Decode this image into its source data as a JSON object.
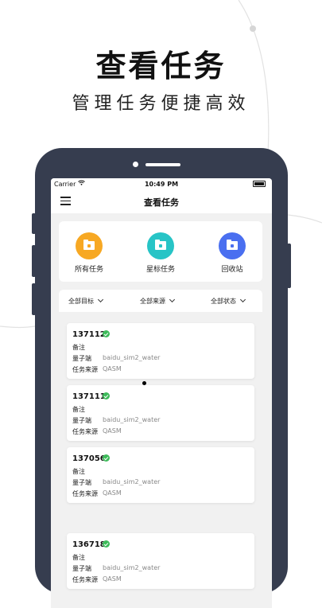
{
  "promo": {
    "title": "查看任务",
    "subtitle": "管理任务便捷高效"
  },
  "status_bar": {
    "carrier": "Carrier",
    "time": "10:49 PM"
  },
  "nav": {
    "title": "查看任务"
  },
  "categories": [
    {
      "label": "所有任务",
      "color": "#f7a823"
    },
    {
      "label": "星标任务",
      "color": "#27c4c6"
    },
    {
      "label": "回收站",
      "color": "#4a6ff0"
    }
  ],
  "filters": [
    {
      "label": "全部目标"
    },
    {
      "label": "全部来源"
    },
    {
      "label": "全部状态"
    }
  ],
  "field_labels": {
    "note": "备注",
    "quantum": "量子端",
    "source": "任务来源"
  },
  "tasks": [
    {
      "id": "137112",
      "note": "",
      "quantum": "baidu_sim2_water",
      "source": "QASM"
    },
    {
      "id": "137111",
      "note": "",
      "quantum": "baidu_sim2_water",
      "source": "QASM"
    },
    {
      "id": "137056",
      "note": "",
      "quantum": "baidu_sim2_water",
      "source": "QASM"
    },
    {
      "id": "136718",
      "note": "",
      "quantum": "baidu_sim2_water",
      "source": "QASM"
    }
  ],
  "colors": {
    "frame": "#363d4f",
    "success": "#3dbb5a"
  }
}
